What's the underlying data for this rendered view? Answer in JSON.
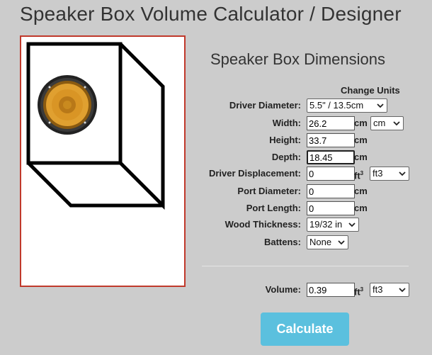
{
  "page": {
    "title": "Speaker Box Volume Calculator / Designer"
  },
  "form": {
    "subtitle": "Speaker Box Dimensions",
    "change_units": "Change Units",
    "driver_diameter": {
      "label": "Driver Diameter:",
      "selected": "5.5\" / 13.5cm"
    },
    "width": {
      "label": "Width:",
      "value": "26.2",
      "unit": "cm",
      "unit_select": "cm"
    },
    "height": {
      "label": "Height:",
      "value": "33.7",
      "unit": "cm"
    },
    "depth": {
      "label": "Depth:",
      "value": "18.45",
      "unit": "cm"
    },
    "driver_displacement": {
      "label": "Driver Displacement:",
      "value": "0",
      "unit": "ft",
      "unit_sup": "3",
      "unit_select": "ft3"
    },
    "port_diameter": {
      "label": "Port Diameter:",
      "value": "0",
      "unit": "cm"
    },
    "port_length": {
      "label": "Port Length:",
      "value": "0",
      "unit": "cm"
    },
    "wood_thickness": {
      "label": "Wood Thickness:",
      "selected": "19/32 in"
    },
    "battens": {
      "label": "Battens:",
      "selected": "None"
    },
    "volume": {
      "label": "Volume:",
      "value": "0.39",
      "unit": "ft",
      "unit_sup": "3",
      "unit_select": "ft3"
    },
    "calculate_label": "Calculate"
  },
  "colors": {
    "accent_button": "#5bc0de",
    "preview_border": "#c0392b",
    "background": "#cccccc"
  },
  "icons": {
    "dropdown": "chevron-down-icon",
    "driver": "speaker-driver-icon"
  }
}
